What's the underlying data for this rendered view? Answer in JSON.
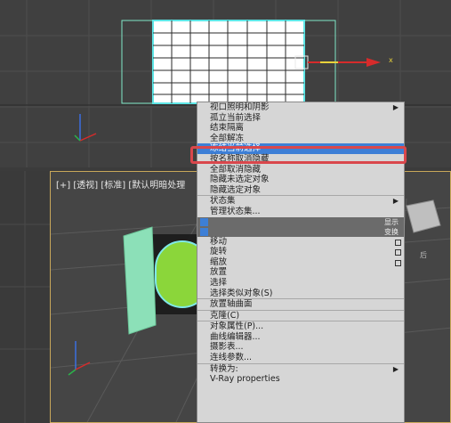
{
  "top_viewport": {
    "axis_label": "x"
  },
  "persp_viewport": {
    "label": "[+] [透视] [标准] [默认明暗处理",
    "viewcube_text": "后"
  },
  "quad_menu": {
    "items": [
      {
        "label": "视口照明和阴影",
        "submenu": true
      },
      {
        "label": "孤立当前选择"
      },
      {
        "label": "结束隔离"
      },
      {
        "label": "全部解冻"
      },
      {
        "label": "冻结当前选择",
        "highlighted": true
      },
      {
        "label": "按名称取消隐藏"
      },
      {
        "label": "全部取消隐藏"
      },
      {
        "label": "隐藏未选定对象"
      },
      {
        "label": "隐藏选定对象"
      },
      {
        "label": "状态集",
        "submenu": true
      },
      {
        "label": "管理状态集..."
      }
    ],
    "band_labels": {
      "display": "显示",
      "transform": "变换"
    },
    "transform_items": [
      {
        "label": "移动",
        "has_box": true
      },
      {
        "label": "旋转",
        "has_box": true
      },
      {
        "label": "缩放",
        "has_box": true
      },
      {
        "label": "放置"
      },
      {
        "label": "选择"
      },
      {
        "label": "选择类似对象(S)"
      },
      {
        "label": "放置轴曲面"
      },
      {
        "label": "克隆(C)"
      },
      {
        "label": "对象属性(P)..."
      },
      {
        "label": "曲线编辑器..."
      },
      {
        "label": "摄影表..."
      },
      {
        "label": "连线参数..."
      },
      {
        "label": "转换为:",
        "submenu": true
      },
      {
        "label": "V-Ray properties"
      }
    ]
  }
}
